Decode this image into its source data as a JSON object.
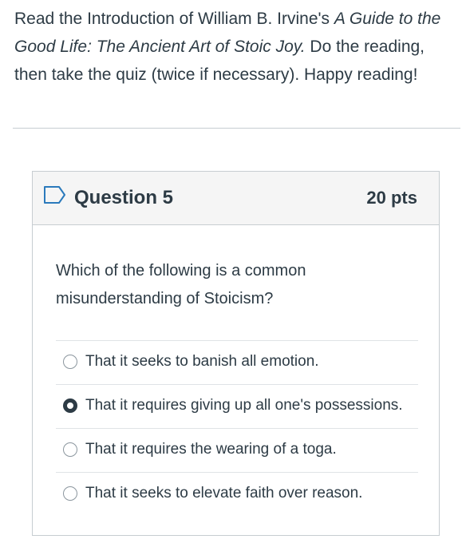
{
  "intro": {
    "text_before": "Read the Introduction of William B. Irvine's ",
    "book_title": "A Guide to the Good Life: The Ancient Art of Stoic Joy.",
    "text_after": " Do the reading, then take the quiz (twice if necessary). Happy reading!"
  },
  "question": {
    "title": "Question 5",
    "points": "20 pts",
    "text": "Which of the following is a common misunderstanding of Stoicism?",
    "flag_icon": "bookmark-flag-icon",
    "answers": [
      {
        "label": "That it seeks to banish all emotion.",
        "selected": false
      },
      {
        "label": "That it requires giving up all one's possessions.",
        "selected": true
      },
      {
        "label": "That it requires the wearing of a toga.",
        "selected": false
      },
      {
        "label": "That it seeks to elevate faith over reason.",
        "selected": false
      }
    ]
  },
  "colors": {
    "text": "#2d3b45",
    "border": "#c7cdd1",
    "header_bg": "#f5f5f5",
    "flag": "#2b7abc"
  }
}
